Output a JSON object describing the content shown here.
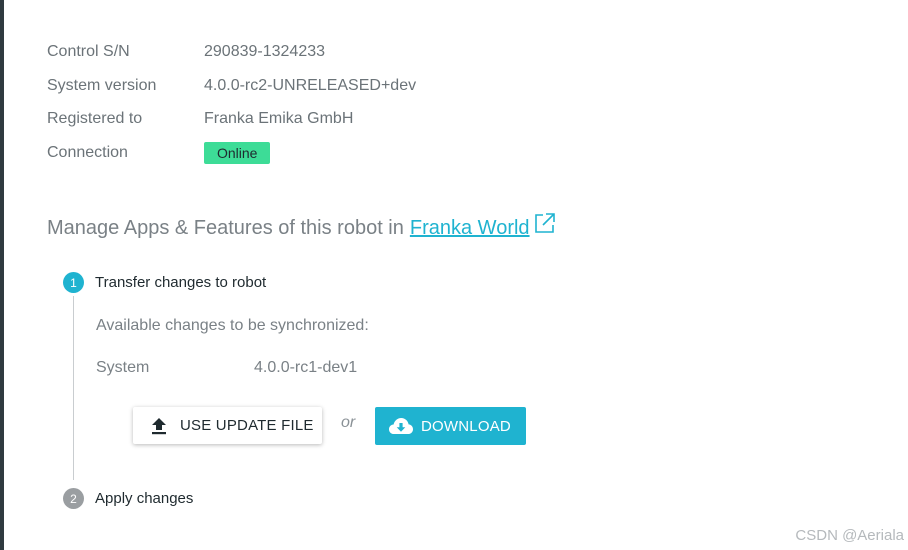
{
  "info": {
    "rows": [
      {
        "label": "Control S/N",
        "value": "290839-1324233"
      },
      {
        "label": "System version",
        "value": "4.0.0-rc2-UNRELEASED+dev"
      },
      {
        "label": "Registered to",
        "value": "Franka Emika GmbH"
      },
      {
        "label": "Connection",
        "value": "Online"
      }
    ]
  },
  "manage": {
    "text": "Manage Apps & Features of this robot in",
    "link": "Franka World"
  },
  "steps": [
    {
      "number": "1",
      "title": "Transfer changes to robot",
      "state": "active"
    },
    {
      "number": "2",
      "title": "Apply changes",
      "state": "inactive"
    }
  ],
  "transfer": {
    "available_label": "Available changes to be synchronized:",
    "component": "System",
    "component_version": "4.0.0-rc1-dev1",
    "use_file_label": "USE UPDATE FILE",
    "or_label": "or",
    "download_label": "DOWNLOAD"
  },
  "watermark": "CSDN @Aeriala",
  "colors": {
    "accent": "#1fb3d0",
    "online_badge": "#3ddc97",
    "inactive_step": "#9a9ea1"
  },
  "icons": {
    "external_link": "external-link-icon",
    "upload": "upload-icon",
    "cloud_download": "cloud-download-icon"
  }
}
